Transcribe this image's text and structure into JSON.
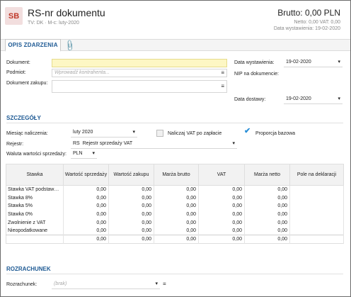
{
  "header": {
    "logo": "SB",
    "title": "RS-nr dokumentu",
    "subtitle": "TV: DK  ·  M-c: luty-2020",
    "brutto": "Brutto: 0,00 PLN",
    "netto_vat": "Netto: 0,00 VAT: 0,00",
    "issue_date_line": "Data wystawienia: 19-02-2020"
  },
  "tabs": {
    "main": "OPIS ZDARZENIA",
    "attachment_icon": "paperclip-icon"
  },
  "form": {
    "dokument_label": "Dokument:",
    "dokument_value": "",
    "podmiot_label": "Podmiot:",
    "podmiot_placeholder": "Wprowadź kontrahenta...",
    "dokument_zakupu_label": "Dokument zakupu:",
    "data_wystawienia_label": "Data wystawienia:",
    "data_wystawienia_value": "19-02-2020",
    "nip_label": "NIP na dokumencie:",
    "data_dostawy_label": "Data dostawy:",
    "data_dostawy_value": "19-02-2020"
  },
  "szczegoly": {
    "title": "SZCZEGÓŁY",
    "miesiac_label": "Miesiąc naliczenia:",
    "miesiac_value": "luty 2020",
    "naliczaj_label": "Naliczaj VAT po zapłacie",
    "naliczaj_checked": false,
    "proporcja_label": "Proporcja bazowa",
    "proporcja_checked": true,
    "rejestr_label": "Rejestr:",
    "rejestr_code": "RS",
    "rejestr_name": "Rejestr sprzedaży VAT",
    "waluta_label": "Waluta wartości sprzedaży:",
    "waluta_value": "PLN"
  },
  "table": {
    "headers": [
      "Stawka",
      "Wartość sprzedaży",
      "Wartość zakupu",
      "Marża brutto",
      "VAT",
      "Marża netto",
      "Pole na deklaracji"
    ],
    "rows": [
      [
        "Stawka VAT podstaw…",
        "0,00",
        "0,00",
        "0,00",
        "0,00",
        "0,00",
        ""
      ],
      [
        "Stawka 8%",
        "0,00",
        "0,00",
        "0,00",
        "0,00",
        "0,00",
        ""
      ],
      [
        "Stawka 5%",
        "0,00",
        "0,00",
        "0,00",
        "0,00",
        "0,00",
        ""
      ],
      [
        "Stawka 0%",
        "0,00",
        "0,00",
        "0,00",
        "0,00",
        "0,00",
        ""
      ],
      [
        "Zwolnienie z VAT",
        "0,00",
        "0,00",
        "0,00",
        "0,00",
        "0,00",
        ""
      ],
      [
        "Nieopodatkowane",
        "0,00",
        "0,00",
        "0,00",
        "0,00",
        "0,00",
        ""
      ]
    ],
    "summary": [
      "",
      "0,00",
      "0,00",
      "0,00",
      "0,00",
      "0,00",
      ""
    ]
  },
  "rozrachunek": {
    "title": "ROZRACHUNEK",
    "label": "Rozrachunek:",
    "placeholder": "(brak)"
  },
  "colors": {
    "accent": "#1e5a94",
    "yellow_field": "#fdf7c4",
    "logo_bg": "#f2dede",
    "logo_fg": "#c0392b",
    "check": "#2a8fd7"
  }
}
